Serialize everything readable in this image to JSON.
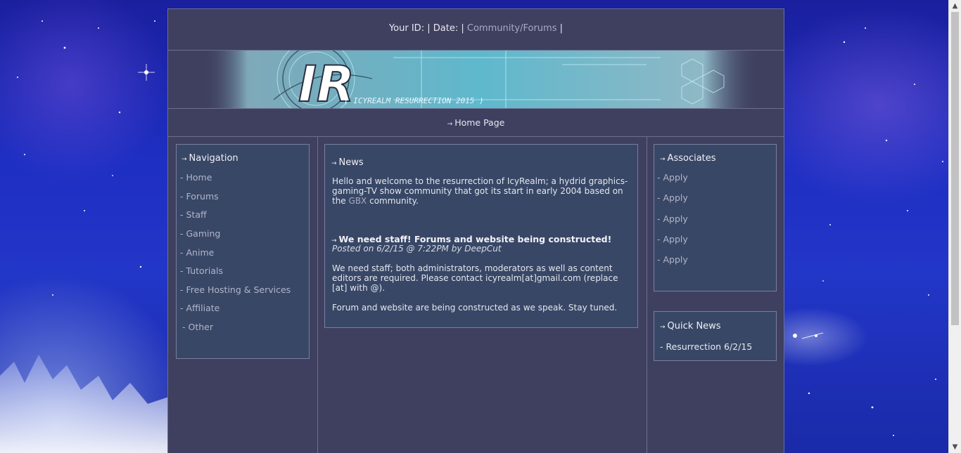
{
  "topbar": {
    "id_label": "Your ID:",
    "sep1": "|",
    "date_label": "Date:",
    "sep2": "|",
    "link": "Community/Forums",
    "sep3": "|"
  },
  "banner": {
    "logo_text": "IR",
    "tagline": "( ICYREALM RESURRECTION 2015 )"
  },
  "homebar": {
    "label": "Home Page"
  },
  "navigation": {
    "title": "Navigation",
    "items": [
      {
        "dash": "-",
        "label": "Home"
      },
      {
        "dash": "-",
        "label": "Forums"
      },
      {
        "dash": "-",
        "label": "Staff"
      },
      {
        "dash": "-",
        "label": "Gaming"
      },
      {
        "dash": "-",
        "label": "Anime"
      },
      {
        "dash": "-",
        "label": "Tutorials"
      },
      {
        "dash": "-",
        "label": "Free Hosting & Services"
      },
      {
        "dash": "-",
        "label": "Affiliate"
      },
      {
        "dash": "-",
        "label": "Other"
      }
    ]
  },
  "news": {
    "title": "News",
    "intro_before": "Hello and welcome to the resurrection of IcyRealm; a hydrid graphics-gaming-TV show community that got its start in early 2004 based on the ",
    "intro_link": "GBX",
    "intro_after": " community.",
    "headline": "We need staff! Forums and website being constructed!",
    "meta": "Posted on 6/2/15 @ 7:22PM by DeepCut",
    "para1": "We need staff; both administrators, moderators as well as content editors are required. Please contact icyrealm[at]gmail.com (replace [at] with @).",
    "para2": "Forum and website are being constructed as we speak. Stay tuned."
  },
  "associates": {
    "title": "Associates",
    "items": [
      {
        "dash": "-",
        "label": "Apply"
      },
      {
        "dash": "-",
        "label": "Apply"
      },
      {
        "dash": "-",
        "label": "Apply"
      },
      {
        "dash": "-",
        "label": "Apply"
      },
      {
        "dash": "-",
        "label": "Apply"
      }
    ]
  },
  "quick_news": {
    "title": "Quick News",
    "items": [
      {
        "dash": "-",
        "label": "Resurrection 6/2/15"
      }
    ]
  },
  "arrow_glyph": "→"
}
